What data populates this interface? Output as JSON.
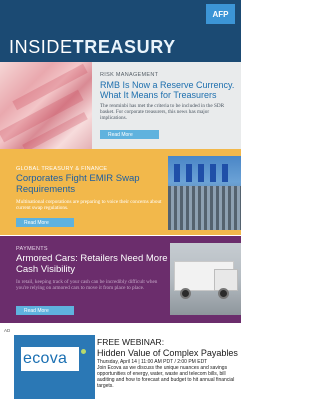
{
  "header": {
    "logo": "AFP",
    "brand_part1": "INSIDE",
    "brand_part2": "TREASURY",
    "colors": {
      "background": "#1b4a73",
      "logo_bg": "#3c95d6"
    }
  },
  "stories": [
    {
      "category": "RISK MANAGEMENT",
      "title": "RMB Is Now a Reserve Currency. What It Means for Treasurers",
      "description": "The renminbi has met the criteria to be included in the SDR basket. For corporate treasurers, this news has major implications.",
      "button": "Read More",
      "image_icon": "currency-notes-image",
      "colors": {
        "background": "#e9ebec",
        "title": "#1d6fae"
      }
    },
    {
      "category": "GLOBAL TREASURY & FINANCE",
      "title": "Corporates Fight EMIR Swap Requirements",
      "description": "Multinational corporations are preparing to voice their concerns about current swap regulations.",
      "button": "Read More",
      "image_icon": "eu-building-flags-image",
      "colors": {
        "background": "#f2b84b",
        "title": "#1d5fa2"
      }
    },
    {
      "category": "PAYMENTS",
      "title": "Armored Cars: Retailers Need More Cash Visibility",
      "description": "In retail, keeping track of your cash can be incredibly difficult when you're relying on armored cars to move it from place to place.",
      "button": "Read More",
      "image_icon": "armored-truck-image",
      "colors": {
        "background": "#6b2d6c",
        "title": "#ffffff"
      }
    }
  ],
  "ad": {
    "label": "AD",
    "logo_text": "ecova",
    "heading": "FREE WEBINAR:",
    "title": "Hidden Value of Complex Payables",
    "datetime": "Thursday, April 14 | 11:00 AM PDT / 2:00 PM EDT",
    "description": "Join Ecova as we discuss the unique nuances and savings opportunities of energy, water, waste and telecom bills, bill auditing and how to forecast and budget to hit annual financial targets.",
    "colors": {
      "logo_bg": "#2b78b5",
      "logo_text": "#1a6fb2"
    }
  },
  "button_color": "#5fb2de"
}
